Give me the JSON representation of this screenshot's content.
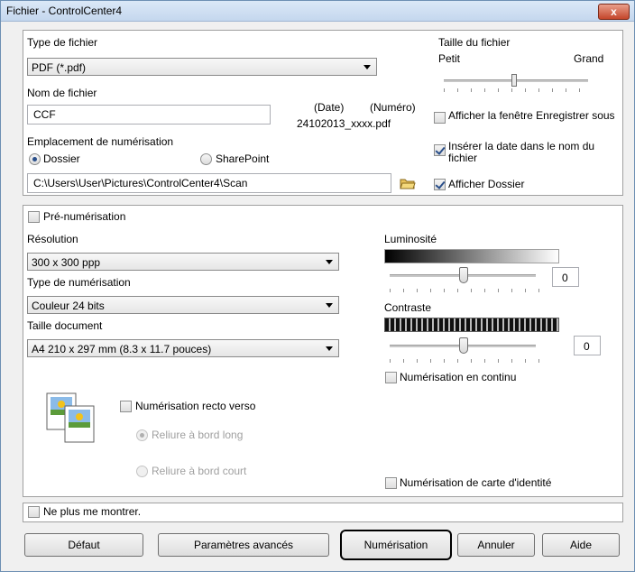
{
  "window": {
    "title": "Fichier - ControlCenter4",
    "close_label": "x"
  },
  "file": {
    "type_label": "Type de fichier",
    "type_value": "PDF (*.pdf)",
    "size_label": "Taille du fichier",
    "size_small": "Petit",
    "size_large": "Grand",
    "size_level_pct": 48,
    "name_label": "Nom de fichier",
    "name_value": "CCF",
    "date_label": "(Date)",
    "number_label": "(Numéro)",
    "name_preview": "24102013_xxxx.pdf",
    "show_save_window": "Afficher la fenêtre Enregistrer sous",
    "show_save_window_checked": false,
    "insert_date": "Insérer la date dans le nom du fichier",
    "insert_date_checked": true,
    "location_label": "Emplacement de numérisation",
    "folder_option": "Dossier",
    "sharepoint_option": "SharePoint",
    "path_value": "C:\\Users\\User\\Pictures\\ControlCenter4\\Scan",
    "show_folder": "Afficher Dossier",
    "show_folder_checked": true
  },
  "scan": {
    "prescan_label": "Pré-numérisation",
    "resolution_label": "Résolution",
    "resolution_value": "300 x 300 ppp",
    "scan_type_label": "Type de numérisation",
    "scan_type_value": "Couleur 24 bits",
    "doc_size_label": "Taille document",
    "doc_size_value": "A4 210 x 297 mm (8.3 x 11.7 pouces)",
    "brightness_label": "Luminosité",
    "brightness_value": "0",
    "contrast_label": "Contraste",
    "contrast_value": "0",
    "continuous_label": "Numérisation en continu",
    "duplex_label": "Numérisation recto verso",
    "long_edge_label": "Reliure à bord long",
    "short_edge_label": "Reliure à bord court",
    "id_card_label": "Numérisation de carte d'identité"
  },
  "footer": {
    "dont_show_label": "Ne plus me montrer.",
    "default_button": "Défaut",
    "advanced_button": "Paramètres avancés",
    "scan_button": "Numérisation",
    "cancel_button": "Annuler",
    "help_button": "Aide"
  }
}
